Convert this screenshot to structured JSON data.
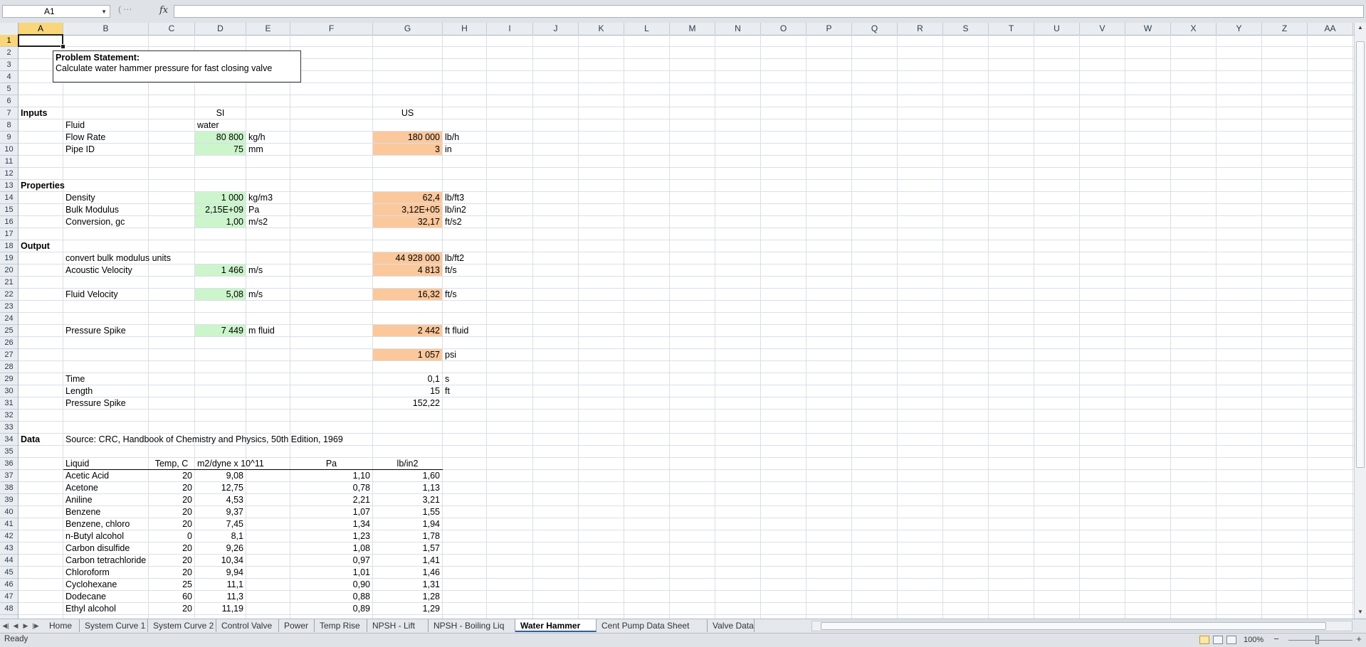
{
  "formula_bar": {
    "name_box": "A1",
    "fx_label": "fx",
    "formula": ""
  },
  "columns": [
    {
      "id": "A",
      "w": 63
    },
    {
      "id": "B",
      "w": 120
    },
    {
      "id": "C",
      "w": 65
    },
    {
      "id": "D",
      "w": 72
    },
    {
      "id": "E",
      "w": 62
    },
    {
      "id": "F",
      "w": 116
    },
    {
      "id": "G",
      "w": 98
    },
    {
      "id": "H",
      "w": 62
    },
    {
      "id": "I",
      "w": 65
    },
    {
      "id": "J",
      "w": 64
    },
    {
      "id": "K",
      "w": 64
    },
    {
      "id": "L",
      "w": 64
    },
    {
      "id": "M",
      "w": 64
    },
    {
      "id": "N",
      "w": 64
    },
    {
      "id": "O",
      "w": 64
    },
    {
      "id": "P",
      "w": 64
    },
    {
      "id": "Q",
      "w": 64
    },
    {
      "id": "R",
      "w": 64
    },
    {
      "id": "S",
      "w": 64
    },
    {
      "id": "T",
      "w": 64
    },
    {
      "id": "U",
      "w": 64
    },
    {
      "id": "V",
      "w": 64
    },
    {
      "id": "W",
      "w": 64
    },
    {
      "id": "X",
      "w": 64
    },
    {
      "id": "Y",
      "w": 64
    },
    {
      "id": "Z",
      "w": 64
    },
    {
      "id": "AA",
      "w": 64
    }
  ],
  "row_count": 48,
  "selected_cell": {
    "col": "A",
    "row": 1
  },
  "problem_statement": {
    "title": "Problem Statement:",
    "text": "Calculate water hammer pressure for fast closing valve"
  },
  "fills": [
    {
      "col": "D",
      "row": 9,
      "color": "green"
    },
    {
      "col": "D",
      "row": 10,
      "color": "green"
    },
    {
      "col": "D",
      "row": 14,
      "color": "green"
    },
    {
      "col": "D",
      "row": 15,
      "color": "green"
    },
    {
      "col": "D",
      "row": 16,
      "color": "green"
    },
    {
      "col": "D",
      "row": 20,
      "color": "green"
    },
    {
      "col": "D",
      "row": 22,
      "color": "green"
    },
    {
      "col": "D",
      "row": 25,
      "color": "green"
    },
    {
      "col": "G",
      "row": 9,
      "color": "orange"
    },
    {
      "col": "G",
      "row": 10,
      "color": "orange"
    },
    {
      "col": "G",
      "row": 14,
      "color": "orange"
    },
    {
      "col": "G",
      "row": 15,
      "color": "orange"
    },
    {
      "col": "G",
      "row": 16,
      "color": "orange"
    },
    {
      "col": "G",
      "row": 19,
      "color": "orange"
    },
    {
      "col": "G",
      "row": 20,
      "color": "orange"
    },
    {
      "col": "G",
      "row": 22,
      "color": "orange"
    },
    {
      "col": "G",
      "row": 25,
      "color": "orange"
    },
    {
      "col": "G",
      "row": 27,
      "color": "orange"
    }
  ],
  "cells": [
    {
      "col": "A",
      "row": 7,
      "v": "Inputs",
      "bold": true
    },
    {
      "col": "D",
      "row": 7,
      "v": "SI",
      "align": "c"
    },
    {
      "col": "G",
      "row": 7,
      "v": "US",
      "align": "c"
    },
    {
      "col": "B",
      "row": 8,
      "v": "Fluid"
    },
    {
      "col": "D",
      "row": 8,
      "v": "water"
    },
    {
      "col": "B",
      "row": 9,
      "v": "Flow Rate"
    },
    {
      "col": "D",
      "row": 9,
      "v": "80 800",
      "align": "r"
    },
    {
      "col": "E",
      "row": 9,
      "v": "kg/h"
    },
    {
      "col": "G",
      "row": 9,
      "v": "180 000",
      "align": "r"
    },
    {
      "col": "H",
      "row": 9,
      "v": "lb/h"
    },
    {
      "col": "B",
      "row": 10,
      "v": "Pipe ID"
    },
    {
      "col": "D",
      "row": 10,
      "v": "75",
      "align": "r"
    },
    {
      "col": "E",
      "row": 10,
      "v": "mm"
    },
    {
      "col": "G",
      "row": 10,
      "v": "3",
      "align": "r"
    },
    {
      "col": "H",
      "row": 10,
      "v": "in"
    },
    {
      "col": "A",
      "row": 13,
      "v": "Properties",
      "bold": true
    },
    {
      "col": "B",
      "row": 14,
      "v": "Density"
    },
    {
      "col": "D",
      "row": 14,
      "v": "1 000",
      "align": "r"
    },
    {
      "col": "E",
      "row": 14,
      "v": "kg/m3"
    },
    {
      "col": "G",
      "row": 14,
      "v": "62,4",
      "align": "r"
    },
    {
      "col": "H",
      "row": 14,
      "v": "lb/ft3"
    },
    {
      "col": "B",
      "row": 15,
      "v": "Bulk Modulus"
    },
    {
      "col": "D",
      "row": 15,
      "v": "2,15E+09",
      "align": "r"
    },
    {
      "col": "E",
      "row": 15,
      "v": "Pa"
    },
    {
      "col": "G",
      "row": 15,
      "v": "3,12E+05",
      "align": "r"
    },
    {
      "col": "H",
      "row": 15,
      "v": "lb/in2"
    },
    {
      "col": "B",
      "row": 16,
      "v": "Conversion, gc"
    },
    {
      "col": "D",
      "row": 16,
      "v": "1,00",
      "align": "r"
    },
    {
      "col": "E",
      "row": 16,
      "v": "m/s2"
    },
    {
      "col": "G",
      "row": 16,
      "v": "32,17",
      "align": "r"
    },
    {
      "col": "H",
      "row": 16,
      "v": "ft/s2"
    },
    {
      "col": "A",
      "row": 18,
      "v": "Output",
      "bold": true
    },
    {
      "col": "B",
      "row": 19,
      "v": "convert bulk modulus units"
    },
    {
      "col": "G",
      "row": 19,
      "v": "44 928 000",
      "align": "r"
    },
    {
      "col": "H",
      "row": 19,
      "v": "lb/ft2"
    },
    {
      "col": "B",
      "row": 20,
      "v": "Acoustic Velocity"
    },
    {
      "col": "D",
      "row": 20,
      "v": "1 466",
      "align": "r"
    },
    {
      "col": "E",
      "row": 20,
      "v": "m/s"
    },
    {
      "col": "G",
      "row": 20,
      "v": "4 813",
      "align": "r"
    },
    {
      "col": "H",
      "row": 20,
      "v": "ft/s"
    },
    {
      "col": "B",
      "row": 22,
      "v": "Fluid Velocity"
    },
    {
      "col": "D",
      "row": 22,
      "v": "5,08",
      "align": "r"
    },
    {
      "col": "E",
      "row": 22,
      "v": "m/s"
    },
    {
      "col": "G",
      "row": 22,
      "v": "16,32",
      "align": "r"
    },
    {
      "col": "H",
      "row": 22,
      "v": "ft/s"
    },
    {
      "col": "B",
      "row": 25,
      "v": "Pressure Spike"
    },
    {
      "col": "D",
      "row": 25,
      "v": "7 449",
      "align": "r"
    },
    {
      "col": "E",
      "row": 25,
      "v": "m fluid"
    },
    {
      "col": "G",
      "row": 25,
      "v": "2 442",
      "align": "r"
    },
    {
      "col": "H",
      "row": 25,
      "v": "ft fluid"
    },
    {
      "col": "G",
      "row": 27,
      "v": "1 057",
      "align": "r"
    },
    {
      "col": "H",
      "row": 27,
      "v": "psi"
    },
    {
      "col": "B",
      "row": 29,
      "v": "Time"
    },
    {
      "col": "G",
      "row": 29,
      "v": "0,1",
      "align": "r"
    },
    {
      "col": "H",
      "row": 29,
      "v": "s"
    },
    {
      "col": "B",
      "row": 30,
      "v": "Length"
    },
    {
      "col": "G",
      "row": 30,
      "v": "15",
      "align": "r"
    },
    {
      "col": "H",
      "row": 30,
      "v": "ft"
    },
    {
      "col": "B",
      "row": 31,
      "v": "Pressure Spike"
    },
    {
      "col": "G",
      "row": 31,
      "v": "152,22",
      "align": "r"
    },
    {
      "col": "A",
      "row": 34,
      "v": "Data",
      "bold": true
    },
    {
      "col": "B",
      "row": 34,
      "v": "Source: CRC, Handbook of Chemistry and Physics, 50th Edition, 1969"
    },
    {
      "col": "B",
      "row": 36,
      "v": "Liquid"
    },
    {
      "col": "C",
      "row": 36,
      "v": "Temp, C",
      "align": "c"
    },
    {
      "col": "D",
      "row": 36,
      "v": "m2/dyne x 10^11"
    },
    {
      "col": "F",
      "row": 36,
      "v": "Pa",
      "align": "c"
    },
    {
      "col": "G",
      "row": 36,
      "v": "lb/in2",
      "align": "c"
    }
  ],
  "data_table": [
    {
      "liquid": "Acetic Acid",
      "temp": "20",
      "comp": "9,08",
      "pa": "1,10",
      "psi": "1,60"
    },
    {
      "liquid": "Acetone",
      "temp": "20",
      "comp": "12,75",
      "pa": "0,78",
      "psi": "1,13"
    },
    {
      "liquid": "Aniline",
      "temp": "20",
      "comp": "4,53",
      "pa": "2,21",
      "psi": "3,21"
    },
    {
      "liquid": "Benzene",
      "temp": "20",
      "comp": "9,37",
      "pa": "1,07",
      "psi": "1,55"
    },
    {
      "liquid": "Benzene, chloro",
      "temp": "20",
      "comp": "7,45",
      "pa": "1,34",
      "psi": "1,94"
    },
    {
      "liquid": "n-Butyl alcohol",
      "temp": "0",
      "comp": "8,1",
      "pa": "1,23",
      "psi": "1,78"
    },
    {
      "liquid": "Carbon disulfide",
      "temp": "20",
      "comp": "9,26",
      "pa": "1,08",
      "psi": "1,57"
    },
    {
      "liquid": "Carbon tetrachloride",
      "temp": "20",
      "comp": "10,34",
      "pa": "0,97",
      "psi": "1,41"
    },
    {
      "liquid": "Chloroform",
      "temp": "20",
      "comp": "9,94",
      "pa": "1,01",
      "psi": "1,46"
    },
    {
      "liquid": "Cyclohexane",
      "temp": "25",
      "comp": "11,1",
      "pa": "0,90",
      "psi": "1,31"
    },
    {
      "liquid": "Dodecane",
      "temp": "60",
      "comp": "11,3",
      "pa": "0,88",
      "psi": "1,28"
    },
    {
      "liquid": "Ethyl alcohol",
      "temp": "20",
      "comp": "11,19",
      "pa": "0,89",
      "psi": "1,29"
    }
  ],
  "sheet_tabs": [
    {
      "label": "Home",
      "active": false
    },
    {
      "label": "System Curve 1",
      "active": false
    },
    {
      "label": "System Curve 2",
      "active": false
    },
    {
      "label": "Control Valve",
      "active": false
    },
    {
      "label": "Power",
      "active": false
    },
    {
      "label": "Temp Rise",
      "active": false
    },
    {
      "label": "NPSH - Lift",
      "active": false
    },
    {
      "label": "NPSH - Boiling Liq",
      "active": false
    },
    {
      "label": "Water Hammer",
      "active": true
    },
    {
      "label": "Cent Pump Data Sheet",
      "active": false
    },
    {
      "label": "Valve Data",
      "active": false
    }
  ],
  "status": {
    "text": "Ready",
    "zoom": "100%"
  },
  "colors": {
    "green": "#ccf5cc",
    "orange": "#fbc89c"
  }
}
